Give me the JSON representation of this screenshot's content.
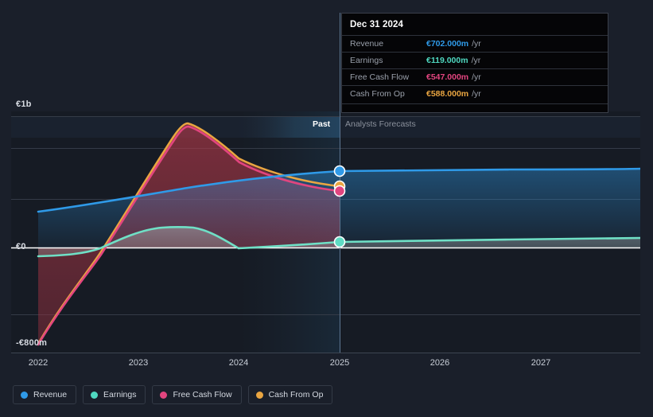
{
  "tooltip": {
    "date": "Dec 31 2024",
    "rows": [
      {
        "label": "Revenue",
        "value": "€702.000m",
        "unit": "/yr",
        "color": "#2f9ae8"
      },
      {
        "label": "Earnings",
        "value": "€119.000m",
        "unit": "/yr",
        "color": "#4fd8c0"
      },
      {
        "label": "Free Cash Flow",
        "value": "€547.000m",
        "unit": "/yr",
        "color": "#e2457f"
      },
      {
        "label": "Cash From Op",
        "value": "€588.000m",
        "unit": "/yr",
        "color": "#e9a541"
      }
    ]
  },
  "phases": {
    "past": "Past",
    "forecast": "Analysts Forecasts"
  },
  "legend": [
    {
      "label": "Revenue",
      "color": "#2f9ae8"
    },
    {
      "label": "Earnings",
      "color": "#4fd8c0"
    },
    {
      "label": "Free Cash Flow",
      "color": "#e2457f"
    },
    {
      "label": "Cash From Op",
      "color": "#e9a541"
    }
  ],
  "chart_data": {
    "type": "line",
    "title": "",
    "xlabel": "",
    "ylabel": "",
    "currency": "EUR",
    "grid": true,
    "legend_position": "bottom-left",
    "x_ticks": [
      "2022",
      "2023",
      "2024",
      "2025",
      "2026",
      "2027"
    ],
    "y_ticks": [
      {
        "label": "€1b",
        "value": 1000
      },
      {
        "label": "€0",
        "value": 0
      },
      {
        "label": "-€800m",
        "value": -800
      }
    ],
    "ylim": [
      -800,
      1000
    ],
    "xlim": [
      2022.0,
      2028.0
    ],
    "divider_x": "2025",
    "past_label": "Past",
    "forecast_label": "Analysts Forecasts",
    "highlight_point_x": "Dec 31 2024",
    "series": [
      {
        "name": "Revenue",
        "color": "#2f9ae8",
        "x": [
          2022.0,
          2022.5,
          2023.0,
          2023.5,
          2024.0,
          2024.5,
          2025.0,
          2025.5,
          2026.0,
          2026.5,
          2027.0,
          2027.5,
          2028.0
        ],
        "values": [
          247,
          285,
          330,
          405,
          520,
          635,
          702,
          706,
          710,
          720,
          735,
          750,
          768
        ],
        "marker_value": 702
      },
      {
        "name": "Earnings",
        "color": "#4fd8c0",
        "x": [
          2022.0,
          2022.5,
          2023.0,
          2023.5,
          2024.0,
          2024.5,
          2025.0,
          2025.5,
          2026.0,
          2026.5,
          2027.0,
          2027.5,
          2028.0
        ],
        "values": [
          -72,
          -30,
          140,
          172,
          -8,
          60,
          119,
          125,
          132,
          140,
          150,
          160,
          172
        ],
        "marker_value": 119
      },
      {
        "name": "Free Cash Flow",
        "color": "#e2457f",
        "x": [
          2022.0,
          2022.5,
          2023.0,
          2023.5,
          2024.0,
          2024.5,
          2025.0
        ],
        "values": [
          -800,
          -330,
          460,
          1010,
          660,
          590,
          547
        ],
        "marker_value": 547
      },
      {
        "name": "Cash From Op",
        "color": "#e9a541",
        "x": [
          2022.0,
          2022.5,
          2023.0,
          2023.5,
          2024.0,
          2024.5,
          2025.0
        ],
        "values": [
          -800,
          -320,
          480,
          1030,
          690,
          625,
          588
        ],
        "marker_value": 588
      }
    ]
  }
}
